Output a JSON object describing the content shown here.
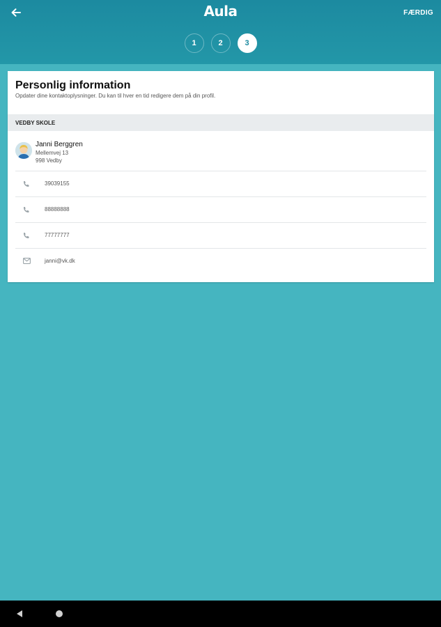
{
  "header": {
    "logo": "Aula",
    "done_label": "FÆRDIG",
    "back_icon": "arrow-left-icon",
    "steps": [
      {
        "label": "1",
        "active": false
      },
      {
        "label": "2",
        "active": false
      },
      {
        "label": "3",
        "active": true
      }
    ]
  },
  "card": {
    "title": "Personlig information",
    "subtitle": "Opdater dine kontaktoplysninger. Du kan til hver en tid redigere dem på din profil.",
    "section": "VEDBY SKOLE",
    "person": {
      "name": "Janni Berggren",
      "address_line1": "Mellemvej 13",
      "address_line2": "998 Vedby"
    },
    "contacts": [
      {
        "icon": "phone-icon",
        "value": "39039155"
      },
      {
        "icon": "phone-icon",
        "value": "88888888"
      },
      {
        "icon": "phone-icon",
        "value": "77777777"
      },
      {
        "icon": "mail-icon",
        "value": "janni@vk.dk"
      }
    ]
  },
  "colors": {
    "header_top": "#1c8aa0",
    "background": "#45b5c0",
    "card": "#ffffff",
    "section_bg": "#e9ecee"
  }
}
